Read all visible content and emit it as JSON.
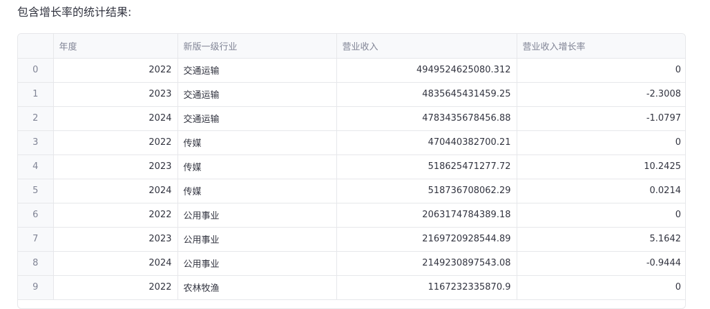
{
  "caption": "包含增长率的统计结果:",
  "table": {
    "columns": [
      "",
      "年度",
      "新版一级行业",
      "营业收入",
      "营业收入增长率"
    ],
    "rows": [
      {
        "index": "0",
        "year": "2022",
        "industry": "交通运输",
        "revenue": "4949524625080.312",
        "growth": "0"
      },
      {
        "index": "1",
        "year": "2023",
        "industry": "交通运输",
        "revenue": "4835645431459.25",
        "growth": "-2.3008"
      },
      {
        "index": "2",
        "year": "2024",
        "industry": "交通运输",
        "revenue": "4783435678456.88",
        "growth": "-1.0797"
      },
      {
        "index": "3",
        "year": "2022",
        "industry": "传媒",
        "revenue": "470440382700.21",
        "growth": "0"
      },
      {
        "index": "4",
        "year": "2023",
        "industry": "传媒",
        "revenue": "518625471277.72",
        "growth": "10.2425"
      },
      {
        "index": "5",
        "year": "2024",
        "industry": "传媒",
        "revenue": "518736708062.29",
        "growth": "0.0214"
      },
      {
        "index": "6",
        "year": "2022",
        "industry": "公用事业",
        "revenue": "2063174784389.18",
        "growth": "0"
      },
      {
        "index": "7",
        "year": "2023",
        "industry": "公用事业",
        "revenue": "2169720928544.89",
        "growth": "5.1642"
      },
      {
        "index": "8",
        "year": "2024",
        "industry": "公用事业",
        "revenue": "2149230897543.08",
        "growth": "-0.9444"
      },
      {
        "index": "9",
        "year": "2022",
        "industry": "农林牧渔",
        "revenue": "1167232335870.9",
        "growth": "0"
      }
    ]
  }
}
